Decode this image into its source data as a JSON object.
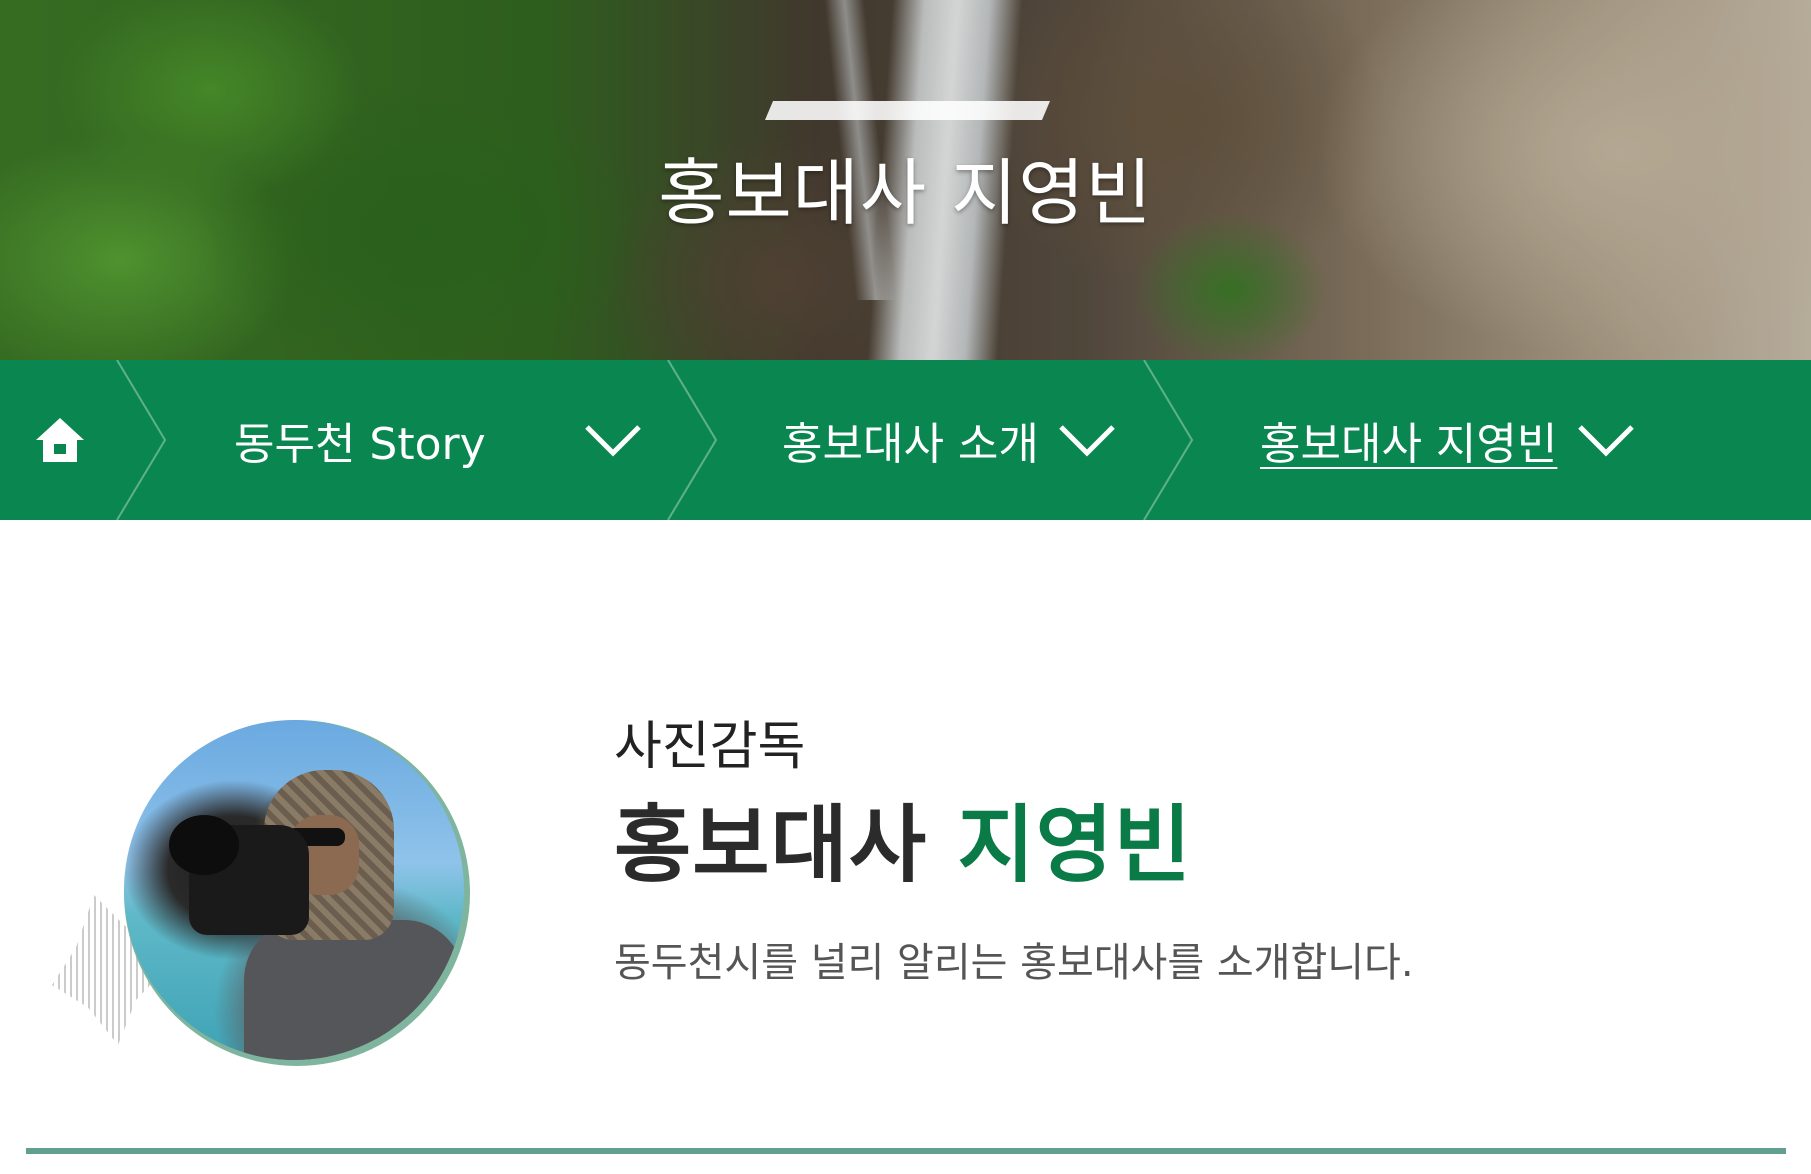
{
  "hero": {
    "title": "홍보대사 지영빈"
  },
  "breadcrumb": {
    "home_icon": "home-icon",
    "items": [
      {
        "label": "동두천 Story",
        "icon": "chevron-down-icon"
      },
      {
        "label": "홍보대사 소개",
        "icon": "chevron-down-icon"
      },
      {
        "label": "홍보대사 지영빈",
        "icon": "chevron-down-icon",
        "current": true
      }
    ]
  },
  "profile": {
    "role": "사진감독",
    "title_prefix": "홍보대사",
    "name": "지영빈",
    "description": "동두천시를 널리 알리는 홍보대사를 소개합니다."
  },
  "colors": {
    "nav_green": "#0a8650",
    "name_accent": "#0a7a47",
    "rule": "#5fa090"
  }
}
